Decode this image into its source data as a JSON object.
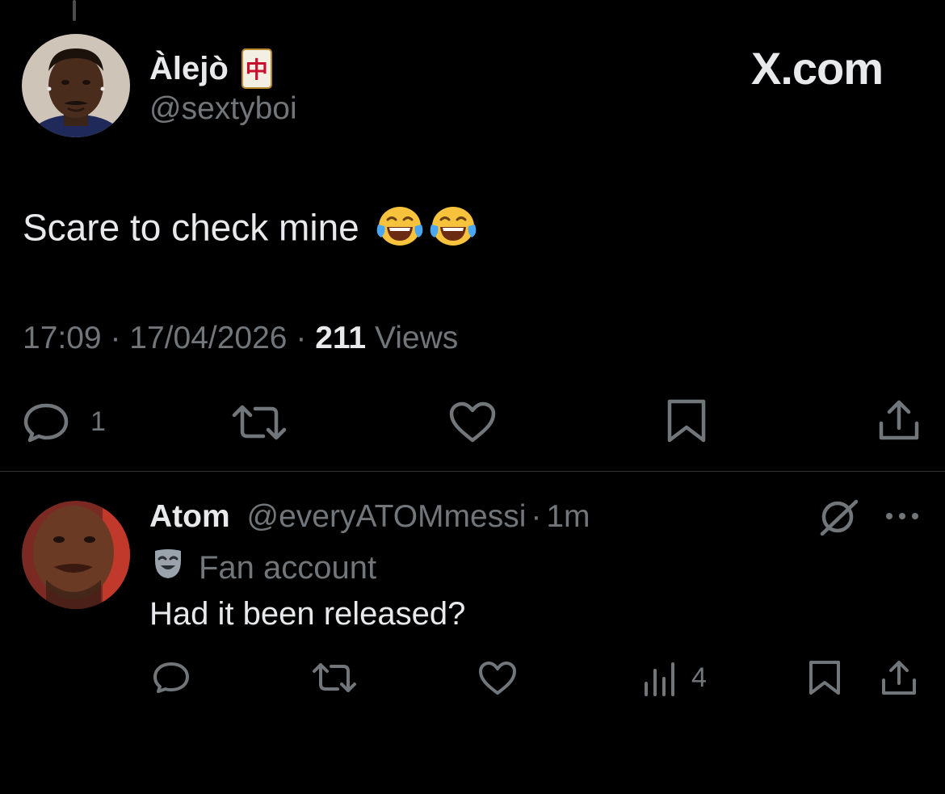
{
  "tweet": {
    "author": {
      "name": "Àlejò",
      "badge": "中",
      "handle": "@sextyboi"
    },
    "brand": "X.com",
    "text": "Scare to check mine",
    "emojis": [
      "face-with-tears-of-joy",
      "face-with-tears-of-joy"
    ],
    "time": "17:09",
    "separator": "·",
    "date": "17/04/2026",
    "views_count": "211",
    "views_label": "Views",
    "actions": {
      "reply_count": "1"
    }
  },
  "reply": {
    "author": {
      "name": "Atom",
      "handle": "@everyATOMmessi",
      "separator": "·",
      "time": "1m"
    },
    "label": "Fan account",
    "text": "Had it been released?",
    "actions": {
      "views_count": "4"
    }
  },
  "colors": {
    "background": "#000000",
    "text_primary": "#e7e9ea",
    "text_secondary": "#71767b",
    "divider": "#2f3336"
  }
}
